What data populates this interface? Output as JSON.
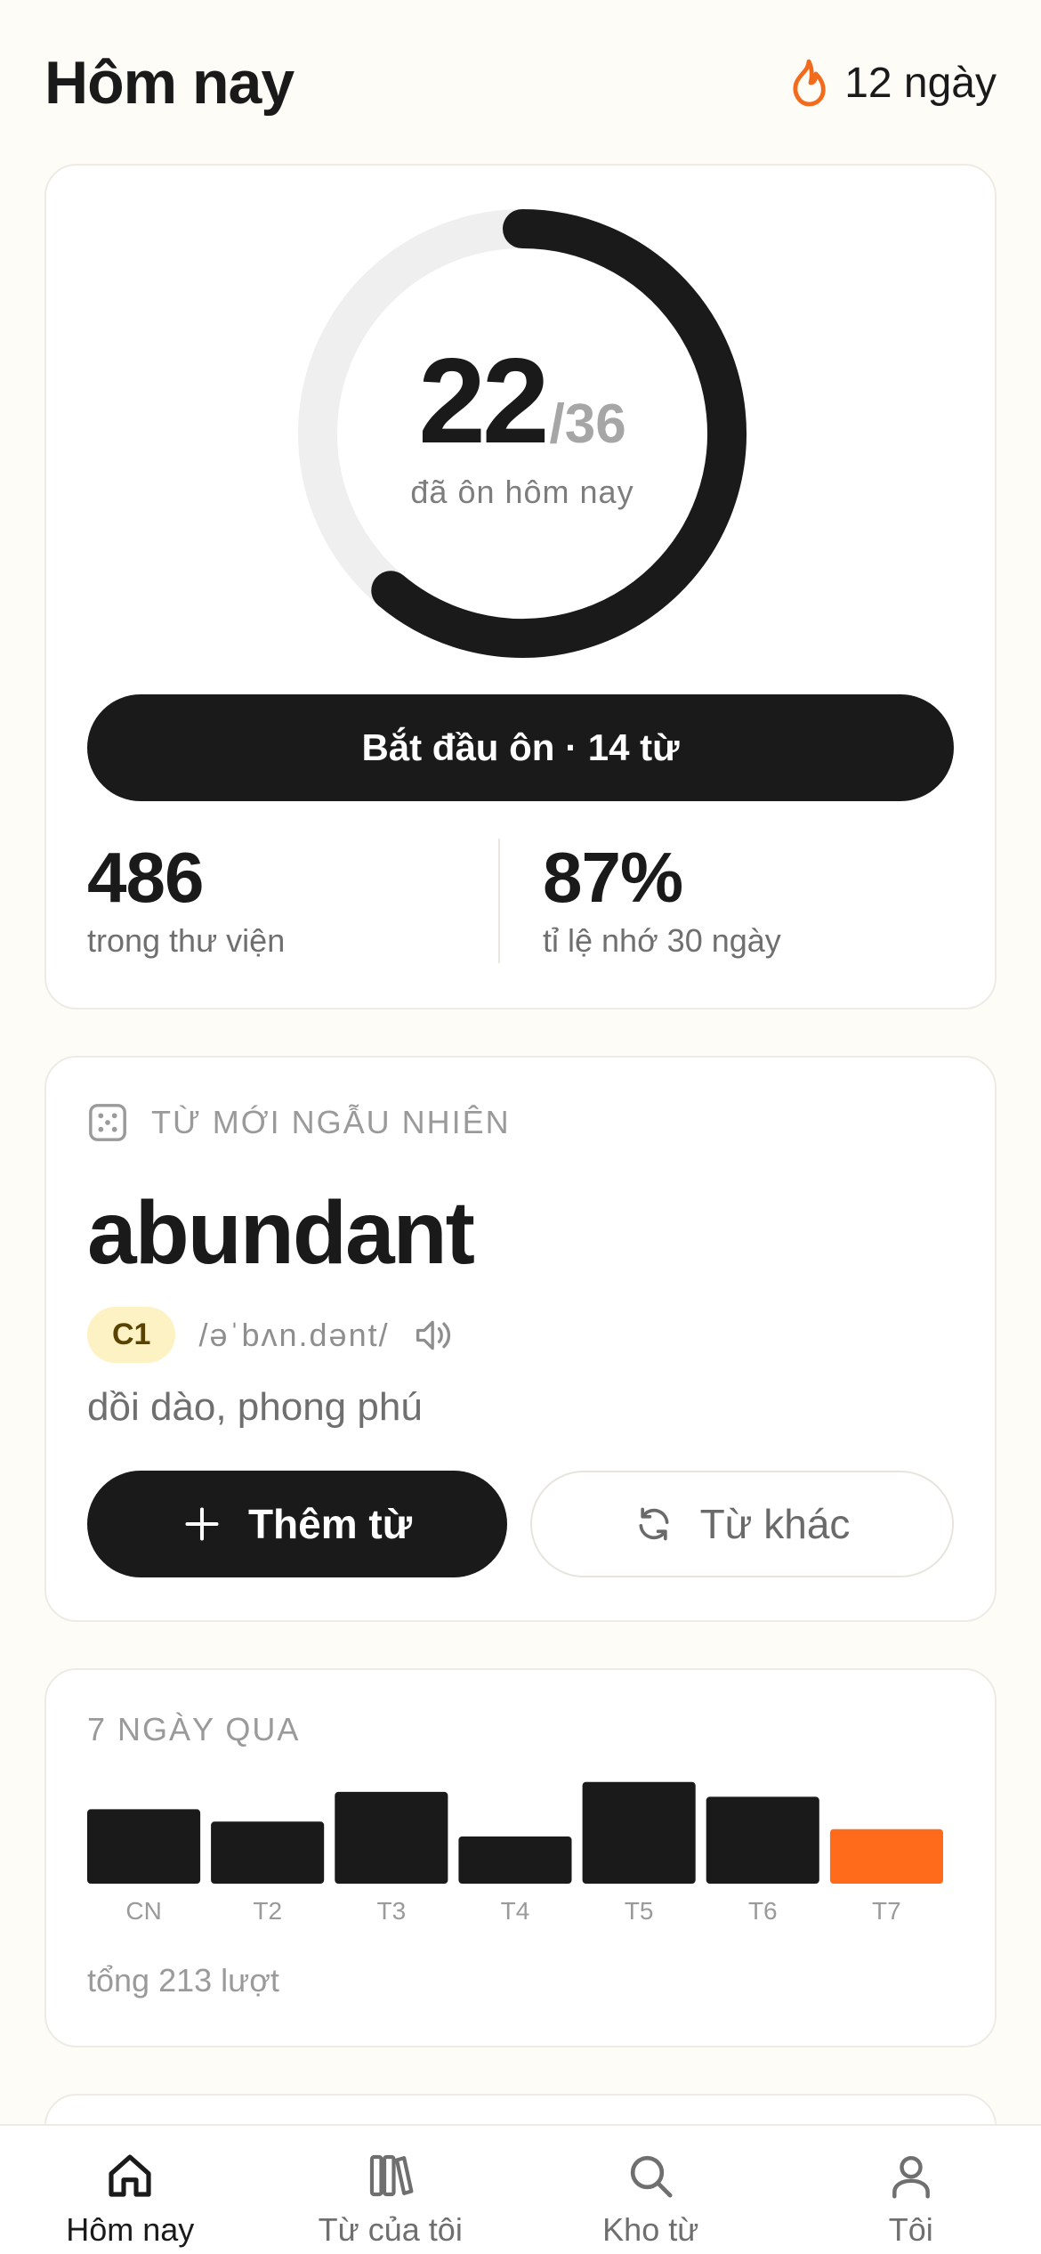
{
  "header": {
    "title": "Hôm nay",
    "streak_text": "12 ngày",
    "streak_icon": "flame-icon"
  },
  "progress": {
    "done": "22",
    "total": "/36",
    "caption": "đã ôn hôm nay",
    "fraction": 0.611,
    "start_button": "Bắt đầu ôn · 14 từ"
  },
  "stats": {
    "library_count": "486",
    "library_label": "trong thư viện",
    "retention": "87%",
    "retention_label": "tỉ lệ nhớ 30 ngày"
  },
  "random_word": {
    "section_label": "TỪ MỚI NGẪU NHIÊN",
    "word": "abundant",
    "level": "C1",
    "ipa": "/əˈbʌn.dənt/",
    "meaning": "dồi dào, phong phú",
    "add_button": "Thêm từ",
    "other_button": "Từ khác"
  },
  "week": {
    "section_label": "7 NGÀY QUA",
    "total": "tổng 213 lượt"
  },
  "chart_data": {
    "type": "bar",
    "categories": [
      "CN",
      "T2",
      "T3",
      "T4",
      "T5",
      "T6",
      "T7"
    ],
    "values": [
      30,
      25,
      37,
      19,
      41,
      35,
      22
    ],
    "highlight_index": 6,
    "colors": {
      "bar": "#1A1A1A",
      "highlight": "#FF6B1A"
    }
  },
  "tabbar": {
    "tabs": [
      {
        "label": "Hôm nay",
        "icon": "home-icon"
      },
      {
        "label": "Từ của tôi",
        "icon": "library-icon"
      },
      {
        "label": "Kho từ",
        "icon": "search-icon"
      },
      {
        "label": "Tôi",
        "icon": "user-icon"
      }
    ]
  },
  "colors": {
    "accent": "#FF6B1A",
    "ink": "#1A1A1A",
    "background": "#FDFCF7"
  }
}
